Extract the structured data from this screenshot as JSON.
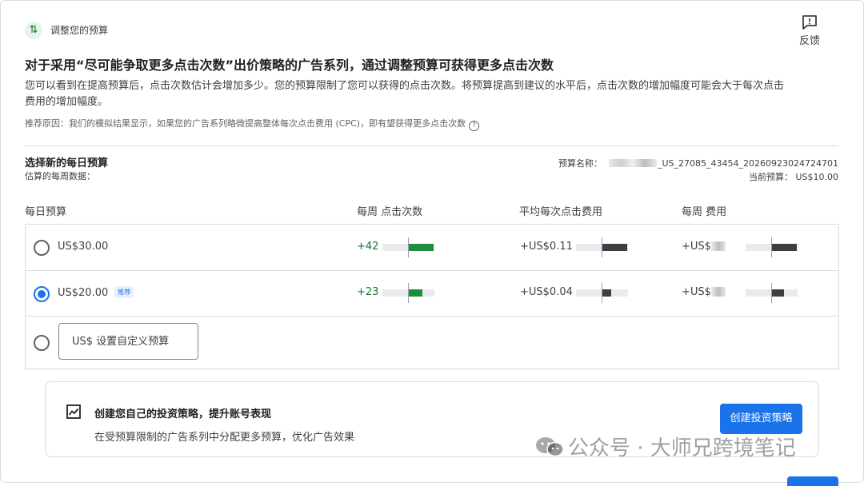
{
  "header": {
    "title": "调整您的预算",
    "icon": "trending-arrows-icon",
    "feedback_label": "反馈"
  },
  "main": {
    "title": "对于采用“尽可能争取更多点击次数”出价策略的广告系列，通过调整预算可获得更多点击次数",
    "description": "您可以看到在提高预算后，点击次数估计会增加多少。您的预算限制了您可以获得的点击次数。将预算提高到建议的水平后，点击次数的增加幅度可能会大于每次点击费用的增加幅度。",
    "reason": "推荐原因：我们的模拟结果显示，如果您的广告系列略微提高整体每次点击费用 (CPC)，即有望获得更多点击次数"
  },
  "budget": {
    "section_title": "选择新的每日预算",
    "section_sub": "估算的每周数据：",
    "name_label": "预算名称：",
    "name_value": "_US_27085_43454_20260923024724701",
    "current_label": "当前预算：",
    "current_value": "US$10.00"
  },
  "table": {
    "headers": {
      "daily": "每日预算",
      "clicks": "每周 点击次数",
      "cpc": "平均每次点击费用",
      "cost": "每周 费用"
    },
    "rows": [
      {
        "amount": "US$30.00",
        "selected": false,
        "clicks": "+42",
        "clicks_bar": 1.0,
        "cpc": "+US$0.11",
        "cpc_bar": 1.0,
        "cost": "+US$",
        "cost_bar": 1.0
      },
      {
        "amount": "US$20.00",
        "selected": true,
        "badge": "推荐",
        "clicks": "+23",
        "clicks_bar": 0.55,
        "cpc": "+US$0.04",
        "cpc_bar": 0.36,
        "cost": "+US$",
        "cost_bar": 0.5
      }
    ],
    "custom_placeholder": "US$ 设置自定义预算"
  },
  "card": {
    "title": "创建您自己的投资策略，提升账号表现",
    "subtitle": "在受预算限制的广告系列中分配更多预算，优化广告效果",
    "button": "创建投资策略"
  },
  "watermark": "公众号 · 大师兄跨境笔记",
  "colors": {
    "accent": "#1a73e8",
    "positive": "#1e8e3e",
    "neutral_bar": "#3c4043"
  }
}
